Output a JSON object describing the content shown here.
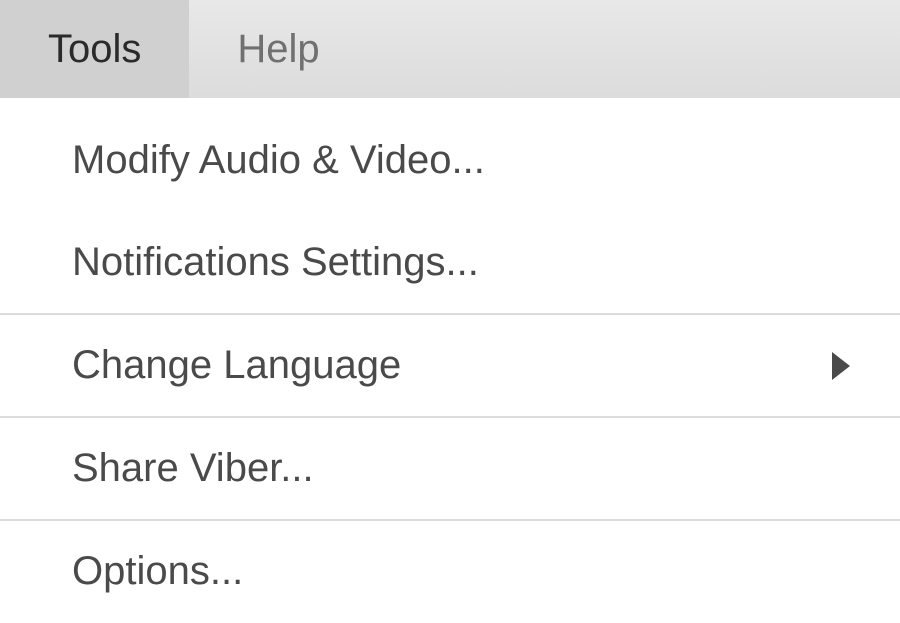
{
  "menubar": {
    "items": [
      {
        "label": "Tools",
        "active": true
      },
      {
        "label": "Help",
        "active": false
      }
    ]
  },
  "dropdown": {
    "items": [
      {
        "label": "Modify Audio & Video...",
        "submenu": false,
        "separator": false
      },
      {
        "label": "Notifications Settings...",
        "submenu": false,
        "separator": true
      },
      {
        "label": "Change Language",
        "submenu": true,
        "separator": true
      },
      {
        "label": "Share Viber...",
        "submenu": false,
        "separator": true
      },
      {
        "label": "Options...",
        "submenu": false,
        "separator": false
      }
    ]
  }
}
